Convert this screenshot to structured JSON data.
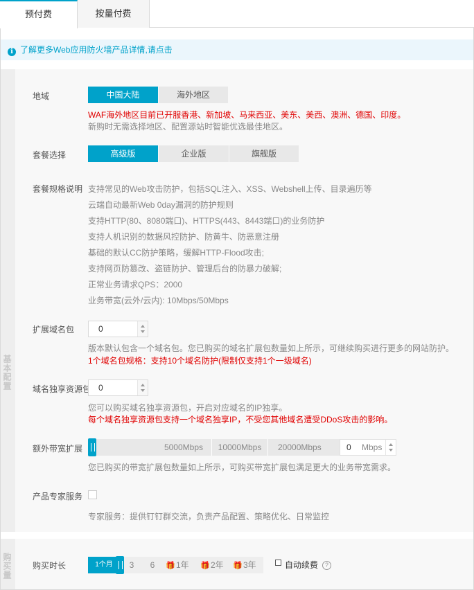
{
  "tabs": [
    {
      "label": "预付费",
      "active": true
    },
    {
      "label": "按量付费",
      "active": false
    }
  ],
  "info": {
    "text": "了解更多Web应用防火墙产品详情,请点击",
    "icon": "info-icon"
  },
  "side_labels": {
    "basic": "基本配置",
    "purchase": "购买量"
  },
  "region": {
    "label": "地域",
    "options": [
      "中国大陆",
      "海外地区"
    ],
    "selected": "中国大陆",
    "note_red": "WAF海外地区目前已开服香港、新加坡、马来西亚、美东、美西、澳洲、德国、印度。",
    "note_gray": "新购时无需选择地区、配置源站时智能优选最佳地区。"
  },
  "package": {
    "label": "套餐选择",
    "options": [
      "高级版",
      "企业版",
      "旗舰版"
    ],
    "selected": "高级版"
  },
  "spec": {
    "label": "套餐规格说明",
    "lines": [
      "支持常见的Web攻击防护，包括SQL注入、XSS、Webshell上传、目录遍历等",
      "云端自动最新Web 0day漏洞的防护规则",
      "支持HTTP(80、8080端口)、HTTPS(443、8443端口)的业务防护",
      "支持人机识别的数据风控防护、防黄牛、防恶意注册",
      "基础的默认CC防护策略，缓解HTTP-Flood攻击;",
      "支持网页防篡改、盗链防护、管理后台的防暴力破解;",
      "正常业务请求QPS：2000",
      "业务带宽(云外/云内): 10Mbps/50Mbps"
    ]
  },
  "ext_domain": {
    "label": "扩展域名包",
    "value": "0",
    "note_gray": "版本默认包含一个域名包。您已购买的域名扩展包数量如上所示，可继续购买进行更多的网站防护。",
    "note_red": "1个域名包规格：支持10个域名防护(限制仅支持1个一级域名)"
  },
  "exclusive": {
    "label": "域名独享资源包",
    "value": "0",
    "note_gray": "您可以购买域名独享资源包，开启对应域名的IP独享。",
    "note_red": "每个域名独享资源包支持一个域名独享IP，不受您其他域名遭受DDoS攻击的影响。"
  },
  "bandwidth": {
    "label": "额外带宽扩展",
    "marks": [
      "5000Mbps",
      "10000Mbps",
      "20000Mbps"
    ],
    "value": "0",
    "unit": "Mbps",
    "level": 0,
    "note": "您已购买的带宽扩展包数量如上所示，可购买带宽扩展包满足更大的业务带宽需求。"
  },
  "expert": {
    "label": "产品专家服务",
    "checked": false,
    "note": "专家服务：提供钉钉群交流，负责产品配置、策略优化、日常监控"
  },
  "duration": {
    "label": "购买时长",
    "selected": "1个月",
    "options": [
      "3",
      "6",
      "1年",
      "2年",
      "3年"
    ],
    "gift_icon": "gift-icon",
    "auto_renew": "自动续费",
    "help": "?"
  },
  "colors": {
    "accent": "#00a2ca",
    "warning": "#e00000",
    "gift": "#f47920"
  }
}
